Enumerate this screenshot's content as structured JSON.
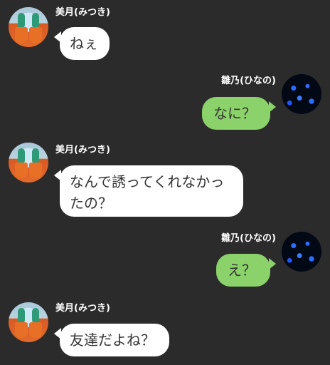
{
  "colors": {
    "background": "#2b2b2b",
    "incoming_bubble": "#ffffff",
    "outgoing_bubble": "#8bd26a",
    "text": "#333333",
    "name_text": "#ffffff"
  },
  "messages": [
    {
      "sender": "美月(みつき)",
      "direction": "incoming",
      "text": "ねぇ"
    },
    {
      "sender": "雛乃(ひなの)",
      "direction": "outgoing",
      "text": "なに？"
    },
    {
      "sender": "美月(みつき)",
      "direction": "incoming",
      "text": "なんで誘ってくれなかったの？"
    },
    {
      "sender": "雛乃(ひなの)",
      "direction": "outgoing",
      "text": "え？"
    },
    {
      "sender": "美月(みつき)",
      "direction": "incoming",
      "text": "友達だよね？"
    }
  ]
}
